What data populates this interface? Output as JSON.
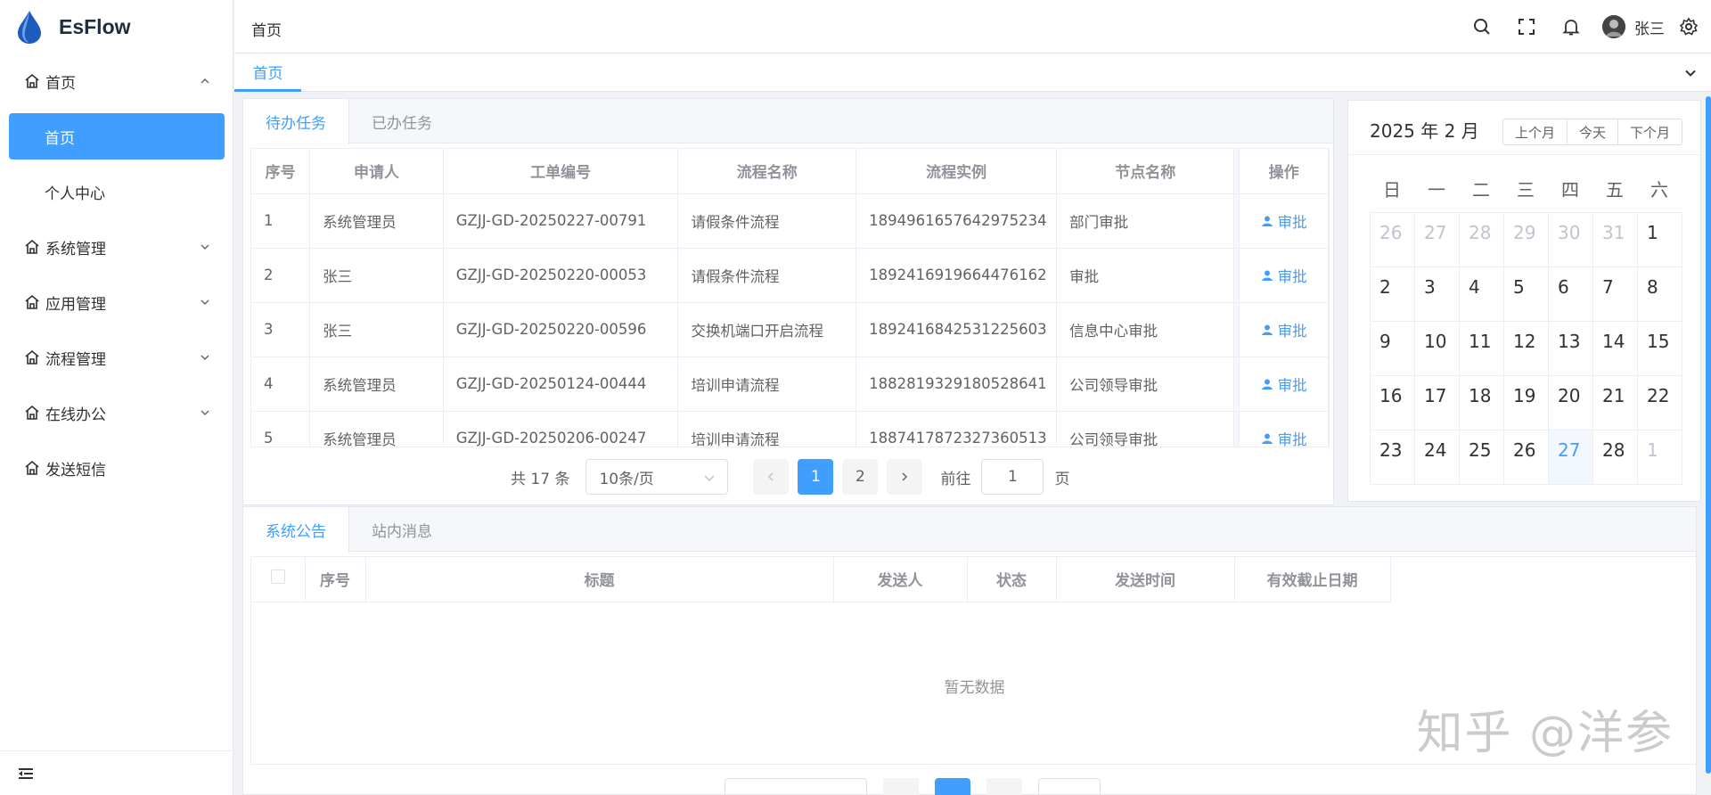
{
  "app": {
    "name": "EsFlow"
  },
  "sidebar": {
    "menu": [
      {
        "label": "首页",
        "expanded": true,
        "children": [
          "首页",
          "个人中心"
        ]
      },
      {
        "label": "系统管理",
        "expanded": false
      },
      {
        "label": "应用管理",
        "expanded": false
      },
      {
        "label": "流程管理",
        "expanded": false
      },
      {
        "label": "在线办公",
        "expanded": false
      },
      {
        "label": "发送短信",
        "expanded": false,
        "leaf": true
      }
    ],
    "active_sub": "首页"
  },
  "header": {
    "breadcrumb": "首页",
    "username": "张三"
  },
  "tagsbar": {
    "active_tag": "首页"
  },
  "tasks": {
    "tabs": [
      "待办任务",
      "已办任务"
    ],
    "active_tab": "待办任务",
    "columns": [
      "序号",
      "申请人",
      "工单编号",
      "流程名称",
      "流程实例",
      "节点名称",
      "操作"
    ],
    "action_label": "审批",
    "rows": [
      [
        "1",
        "系统管理员",
        "GZJJ-GD-20250227-00791",
        "请假条件流程",
        "1894961657642975234",
        "部门审批"
      ],
      [
        "2",
        "张三",
        "GZJJ-GD-20250220-00053",
        "请假条件流程",
        "1892416919664476162",
        "审批"
      ],
      [
        "3",
        "张三",
        "GZJJ-GD-20250220-00596",
        "交换机端口开启流程",
        "1892416842531225603",
        "信息中心审批"
      ],
      [
        "4",
        "系统管理员",
        "GZJJ-GD-20250124-00444",
        "培训申请流程",
        "1882819329180528641",
        "公司领导审批"
      ],
      [
        "5",
        "系统管理员",
        "GZJJ-GD-20250206-00247",
        "培训申请流程",
        "1887417872327360513",
        "公司领导审批"
      ]
    ],
    "pager": {
      "total_text": "共 17 条",
      "page_size": "10条/页",
      "pages": [
        "1",
        "2"
      ],
      "current": "1",
      "goto_label": "前往",
      "goto_value": "1",
      "page_unit": "页"
    }
  },
  "calendar": {
    "title": "2025 年 2 月",
    "buttons": [
      "上个月",
      "今天",
      "下个月"
    ],
    "weekdays": [
      "日",
      "一",
      "二",
      "三",
      "四",
      "五",
      "六"
    ],
    "weeks": [
      [
        [
          "26",
          "prev"
        ],
        [
          "27",
          "prev"
        ],
        [
          "28",
          "prev"
        ],
        [
          "29",
          "prev"
        ],
        [
          "30",
          "prev"
        ],
        [
          "31",
          "prev"
        ],
        [
          "1",
          "cur"
        ]
      ],
      [
        [
          "2",
          "cur"
        ],
        [
          "3",
          "cur"
        ],
        [
          "4",
          "cur"
        ],
        [
          "5",
          "cur"
        ],
        [
          "6",
          "cur"
        ],
        [
          "7",
          "cur"
        ],
        [
          "8",
          "cur"
        ]
      ],
      [
        [
          "9",
          "cur"
        ],
        [
          "10",
          "cur"
        ],
        [
          "11",
          "cur"
        ],
        [
          "12",
          "cur"
        ],
        [
          "13",
          "cur"
        ],
        [
          "14",
          "cur"
        ],
        [
          "15",
          "cur"
        ]
      ],
      [
        [
          "16",
          "cur"
        ],
        [
          "17",
          "cur"
        ],
        [
          "18",
          "cur"
        ],
        [
          "19",
          "cur"
        ],
        [
          "20",
          "cur"
        ],
        [
          "21",
          "cur"
        ],
        [
          "22",
          "cur"
        ]
      ],
      [
        [
          "23",
          "cur"
        ],
        [
          "24",
          "cur"
        ],
        [
          "25",
          "cur"
        ],
        [
          "26",
          "cur"
        ],
        [
          "27",
          "today"
        ],
        [
          "28",
          "cur"
        ],
        [
          "1",
          "next"
        ]
      ]
    ]
  },
  "notices": {
    "tabs": [
      "系统公告",
      "站内消息"
    ],
    "active_tab": "系统公告",
    "columns": [
      "序号",
      "标题",
      "发送人",
      "状态",
      "发送时间",
      "有效截止日期"
    ],
    "empty_text": "暂无数据"
  },
  "watermark": "知乎 @洋参",
  "colors": {
    "primary": "#409eff",
    "sidebar_bg": "#ffffff",
    "page_bg": "#f0f2f5"
  }
}
